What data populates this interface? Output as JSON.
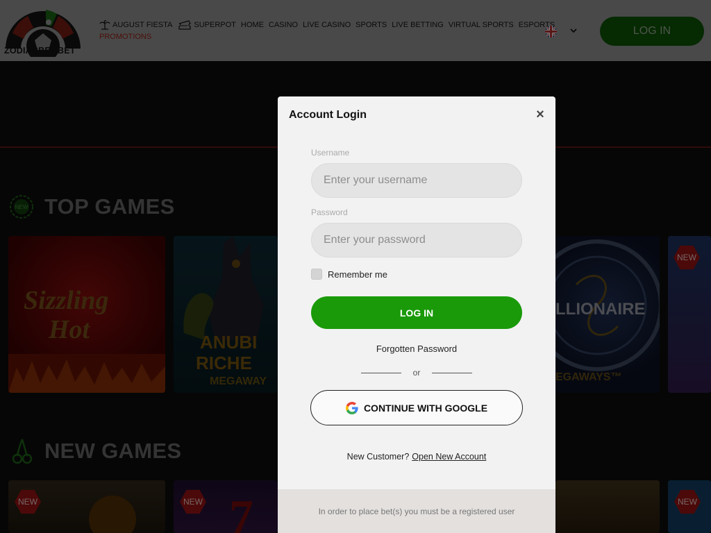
{
  "header": {
    "logo_text": "ZODIACBET.BET",
    "nav_items": [
      {
        "label": "AUGUST FIESTA",
        "icon": "palm-tree-icon"
      },
      {
        "label": "SUPERPOT",
        "icon": "ticket-icon"
      },
      {
        "label": "HOME"
      },
      {
        "label": "CASINO"
      },
      {
        "label": "LIVE CASINO"
      },
      {
        "label": "SPORTS"
      },
      {
        "label": "LIVE BETTING"
      },
      {
        "label": "VIRTUAL SPORTS"
      },
      {
        "label": "ESPORTS"
      }
    ],
    "promotions_label": "PROMOTIONS",
    "language_icon": "uk-flag-icon",
    "login_label": "LOG IN"
  },
  "sections": {
    "top_games": "TOP GAMES",
    "new_games": "NEW GAMES",
    "new_badge": "NEW"
  },
  "colors": {
    "accent_green": "#1a9a09",
    "promo_red": "#8a1a10"
  },
  "modal": {
    "title": "Account Login",
    "username_label": "Username",
    "username_placeholder": "Enter your username",
    "password_label": "Password",
    "password_placeholder": "Enter your password",
    "remember_label": "Remember me",
    "login_button": "LOG IN",
    "forgot_label": "Forgotten Password",
    "or_label": "or",
    "google_button": "CONTINUE WITH GOOGLE",
    "new_customer_text": "New Customer?",
    "open_account_link": "Open New Account",
    "footer_text": "In order to place bet(s) you must be a registered user"
  }
}
